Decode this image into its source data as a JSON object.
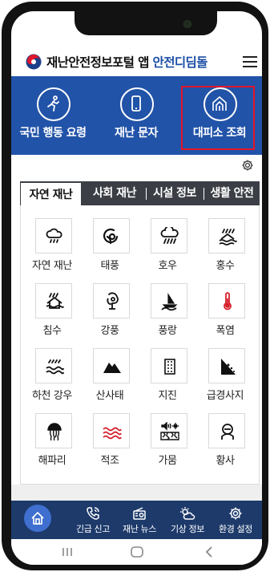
{
  "header": {
    "title_prefix": "재난안전정보포털 앱 ",
    "title_accent": "안전디딤돌",
    "accent_color": "#1c4ea6"
  },
  "banner": {
    "bg_color": "#2153a8",
    "items": [
      {
        "label": "국민 행동 요령",
        "icon": "running-person-icon"
      },
      {
        "label": "재난 문자",
        "icon": "smartphone-icon"
      },
      {
        "label": "대피소 조회",
        "icon": "shelter-icon"
      }
    ],
    "highlight_color": "#e2162c"
  },
  "tabs": [
    {
      "label": "자연 재난",
      "active": true
    },
    {
      "label": "사회 재난",
      "active": false
    },
    {
      "label": "시설 정보",
      "active": false
    },
    {
      "label": "생활 안전",
      "active": false
    }
  ],
  "disasters": [
    {
      "label": "자연 재난",
      "icon": "cloud-rain-icon"
    },
    {
      "label": "태풍",
      "icon": "typhoon-icon"
    },
    {
      "label": "호우",
      "icon": "heavy-rain-icon"
    },
    {
      "label": "홍수",
      "icon": "flood-icon"
    },
    {
      "label": "침수",
      "icon": "inundation-icon"
    },
    {
      "label": "강풍",
      "icon": "strong-wind-icon"
    },
    {
      "label": "풍랑",
      "icon": "high-waves-icon"
    },
    {
      "label": "폭염",
      "icon": "thermometer-icon"
    },
    {
      "label": "하천 강우",
      "icon": "river-rain-icon"
    },
    {
      "label": "산사태",
      "icon": "landslide-icon"
    },
    {
      "label": "지진",
      "icon": "earthquake-icon"
    },
    {
      "label": "급경사지",
      "icon": "steep-slope-icon"
    },
    {
      "label": "해파리",
      "icon": "jellyfish-icon"
    },
    {
      "label": "적조",
      "icon": "red-tide-icon"
    },
    {
      "label": "가뭄",
      "icon": "drought-icon"
    },
    {
      "label": "황사",
      "icon": "yellow-dust-icon"
    }
  ],
  "bottom_nav": {
    "items": [
      {
        "label": "긴급 신고",
        "icon": "phone-call-icon"
      },
      {
        "label": "재난 뉴스",
        "icon": "radio-icon"
      },
      {
        "label": "기상 정보",
        "icon": "weather-icon"
      },
      {
        "label": "환경 설정",
        "icon": "settings-icon"
      }
    ]
  }
}
